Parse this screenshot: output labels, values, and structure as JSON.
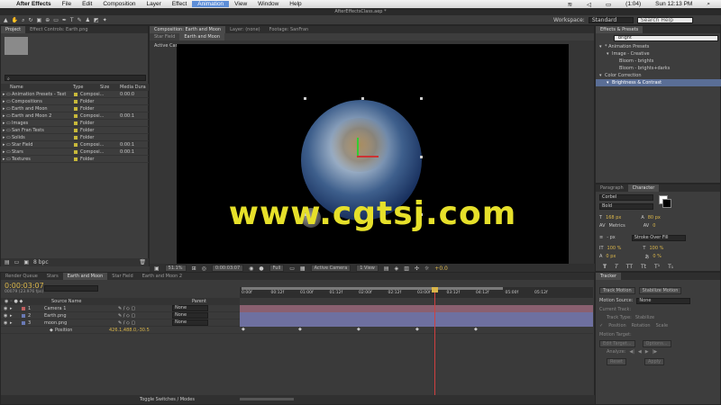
{
  "menubar": {
    "apple": "",
    "app": "After Effects",
    "items": [
      "File",
      "Edit",
      "Composition",
      "Layer",
      "Effect",
      "Animation",
      "View",
      "Window",
      "Help"
    ],
    "battery": "(1:04)",
    "clock": "Sun 12:13 PM"
  },
  "window_title": "AfterEffectsClass.aep *",
  "workspace": {
    "label": "Workspace:",
    "value": "Standard",
    "search_placeholder": "Search Help"
  },
  "project": {
    "tabs": [
      "Project",
      "Effect Controls: Earth.png"
    ],
    "columns": {
      "name": "Name",
      "type": "Type",
      "size": "Size",
      "duration": "Media Dura"
    },
    "items": [
      {
        "name": "Animation Presets - Text",
        "type": "Composi...",
        "dur": "0:00:0",
        "color": "#c8b93a"
      },
      {
        "name": "Compositions",
        "type": "Folder",
        "dur": "",
        "color": "#c8b93a"
      },
      {
        "name": "Earth and Moon",
        "type": "Folder",
        "dur": "",
        "color": "#c8b93a"
      },
      {
        "name": "Earth and Moon 2",
        "type": "Composi...",
        "dur": "0:00:1",
        "color": "#c8b93a"
      },
      {
        "name": "Images",
        "type": "Folder",
        "dur": "",
        "color": "#c8b93a"
      },
      {
        "name": "San Fran Tests",
        "type": "Folder",
        "dur": "",
        "color": "#c8b93a"
      },
      {
        "name": "Solids",
        "type": "Folder",
        "dur": "",
        "color": "#c8b93a"
      },
      {
        "name": "Star Field",
        "type": "Composi...",
        "dur": "0:00:1",
        "color": "#c8b93a"
      },
      {
        "name": "Stars",
        "type": "Composi...",
        "dur": "0:00:1",
        "color": "#c8b93a"
      },
      {
        "name": "Textures",
        "type": "Folder",
        "dur": "",
        "color": "#c8b93a"
      }
    ],
    "bpc": "8 bpc"
  },
  "comp": {
    "tab": "Composition: Earth and Moon",
    "tabs": [
      "Layer: (none)",
      "Footage: SanFran"
    ],
    "subtabs": [
      "Star Field",
      "Earth and Moon"
    ],
    "view_label": "Active Camera",
    "zoom": "51.1%",
    "timecode": "0:00:03:07",
    "resolution": "Full",
    "camera": "Active Camera",
    "views": "1 View",
    "exposure": "+0.0"
  },
  "watermark": "www.cgtsj.com",
  "effects": {
    "tab": "Effects & Presets",
    "search": "bright",
    "tree": [
      {
        "label": "* Animation Presets",
        "indent": 0,
        "selected": false
      },
      {
        "label": "Image - Creative",
        "indent": 1,
        "selected": false
      },
      {
        "label": "Bloom - brights",
        "indent": 2,
        "selected": false
      },
      {
        "label": "Bloom - brights+darks",
        "indent": 2,
        "selected": false
      },
      {
        "label": "Color Correction",
        "indent": 0,
        "selected": false
      },
      {
        "label": "Brightness & Contrast",
        "indent": 1,
        "selected": true
      }
    ]
  },
  "character": {
    "tabs": [
      "Paragraph",
      "Character"
    ],
    "font": "Corbel",
    "style": "Bold",
    "size": "168 px",
    "leading": "80 px",
    "kerning": "Metrics",
    "tracking": "0",
    "stroke_width": "- px",
    "stroke_type": "Stroke Over Fill",
    "vscale": "100 %",
    "hscale": "100 %",
    "baseline": "0 px",
    "tsume": "0 %",
    "styles": [
      "T",
      "T",
      "TT",
      "Tt",
      "T¹",
      "T₁"
    ]
  },
  "timeline": {
    "tabs": [
      "Render Queue",
      "Stars",
      "Earth and Moon",
      "Star Field",
      "Earth and Moon 2"
    ],
    "timecode": "0:00:03:07",
    "fps": "00079 (23.976 fps)",
    "col_source": "Source Name",
    "col_parent": "Parent",
    "layers": [
      {
        "num": "1",
        "name": "Camera 1",
        "parent": "None",
        "color": "#c06060"
      },
      {
        "num": "2",
        "name": "Earth.png",
        "parent": "None",
        "color": "#6a7ab5"
      },
      {
        "num": "3",
        "name": "moon.png",
        "parent": "None",
        "color": "#6a7ab5"
      }
    ],
    "prop_name": "Position",
    "prop_value": "426.1,488.0,-30.5",
    "ruler": [
      "0:00f",
      "00:12f",
      "01:00f",
      "01:12f",
      "02:00f",
      "02:12f",
      "03:00f",
      "03:12f",
      "04:12f",
      "05:00f",
      "05:12f"
    ],
    "toggle": "Toggle Switches / Modes"
  },
  "tracker": {
    "tab": "Tracker",
    "buttons": [
      "Track Motion",
      "Stabilize Motion"
    ],
    "motion_source_label": "Motion Source:",
    "motion_source": "None",
    "current_track": "Current Track:",
    "track_type": "Track Type:",
    "track_type_val": "Stabilize",
    "options": [
      "Position",
      "Rotation",
      "Scale"
    ],
    "motion_target": "Motion Target:",
    "edit_target": "Edit Target...",
    "options_btn": "Options...",
    "analyze": "Analyze:",
    "reset": "Reset",
    "apply": "Apply"
  }
}
